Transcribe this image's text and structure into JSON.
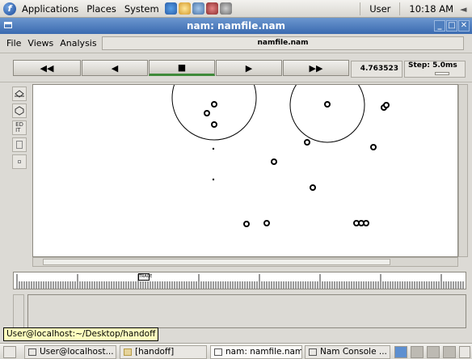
{
  "panel": {
    "menus": [
      "Applications",
      "Places",
      "System"
    ],
    "user": "User",
    "time": "10:18 AM"
  },
  "window": {
    "title": "nam: namfile.nam"
  },
  "menubar": {
    "file": "File",
    "views": "Views",
    "analysis": "Analysis",
    "filename": "namfile.nam"
  },
  "controls": {
    "rewind": "◀◀",
    "back": "◀",
    "stop": "■",
    "play": "▶",
    "fastforward": "▶▶",
    "time": "4.763523",
    "step_label": "Step: 5.0ms"
  },
  "tools": {
    "edit_label": "ED\nIT"
  },
  "timeline": {
    "marker": "TRACE"
  },
  "tooltip": "User@localhost:~/Desktop/handoff",
  "taskbar": {
    "tasks": [
      "User@localhost...",
      "[handoff]",
      "nam: namfile.nam",
      "Nam Console ..."
    ]
  },
  "colors": {
    "title_bar": "#3a6ab0",
    "accent_green": "#3f8a3a",
    "tooltip": "#ffffbf"
  }
}
